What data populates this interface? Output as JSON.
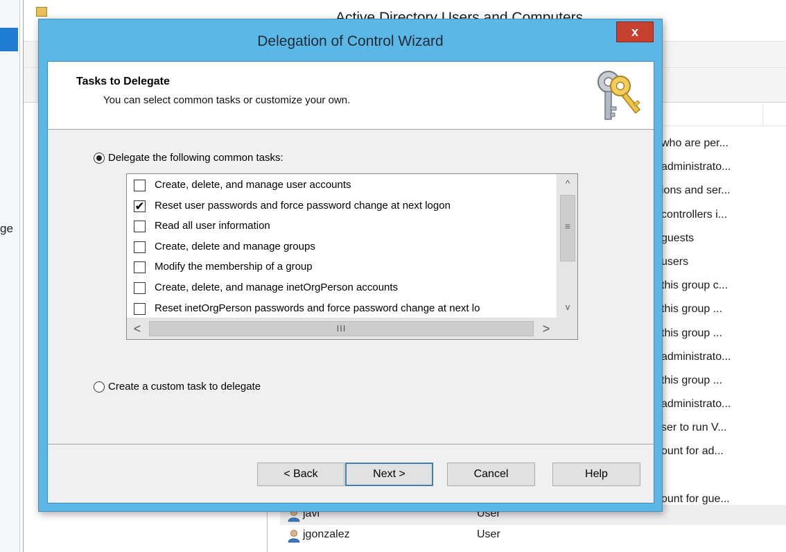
{
  "background_window": {
    "title": "Active Directory Users and Computers",
    "left_partial_text": "ge",
    "description_column": [
      "who are per...",
      "administrato...",
      "ions and ser...",
      "controllers i...",
      "guests",
      "users",
      "this group c...",
      "this group ...",
      "this group ...",
      "administrato...",
      "this group ...",
      "administrato...",
      "ser to run V...",
      "ount for ad...",
      "",
      "ount for gue..."
    ],
    "rows": [
      {
        "name": "javi",
        "type": "User"
      },
      {
        "name": "jgonzalez",
        "type": "User"
      }
    ]
  },
  "dialog": {
    "title": "Delegation of Control Wizard",
    "close_label": "x",
    "header_title": "Tasks to Delegate",
    "header_subtitle": "You can select common tasks or customize your own.",
    "option_common_label": "Delegate the following common tasks:",
    "option_common_selected": true,
    "option_custom_label": "Create a custom task to delegate",
    "option_custom_selected": false,
    "tasks": [
      {
        "label": "Create, delete, and manage user accounts",
        "checked": false,
        "mark": ""
      },
      {
        "label": "Reset user passwords and force password change at next logon",
        "checked": true,
        "mark": "✔"
      },
      {
        "label": "Read all user information",
        "checked": false,
        "mark": ""
      },
      {
        "label": "Create, delete and manage groups",
        "checked": false,
        "mark": ""
      },
      {
        "label": "Modify the membership of a group",
        "checked": false,
        "mark": ""
      },
      {
        "label": "Create, delete, and manage inetOrgPerson accounts",
        "checked": false,
        "mark": ""
      },
      {
        "label": "Reset inetOrgPerson passwords and force password change at next lo",
        "checked": false,
        "mark": ""
      }
    ],
    "scroll_up_glyph": "^",
    "scroll_down_glyph": "v",
    "scroll_v_grip": "≡",
    "scroll_left_glyph": "<",
    "scroll_right_glyph": ">",
    "scroll_h_grip": "III",
    "buttons": {
      "back": "< Back",
      "next": "Next >",
      "cancel": "Cancel",
      "help": "Help"
    }
  },
  "colors": {
    "dialog_frame": "#5bb8e6",
    "close_button": "#c7402f",
    "default_button_border": "#3c7fb1"
  },
  "icons": {
    "dialog_header": "keys-icon",
    "user": "user-icon"
  }
}
